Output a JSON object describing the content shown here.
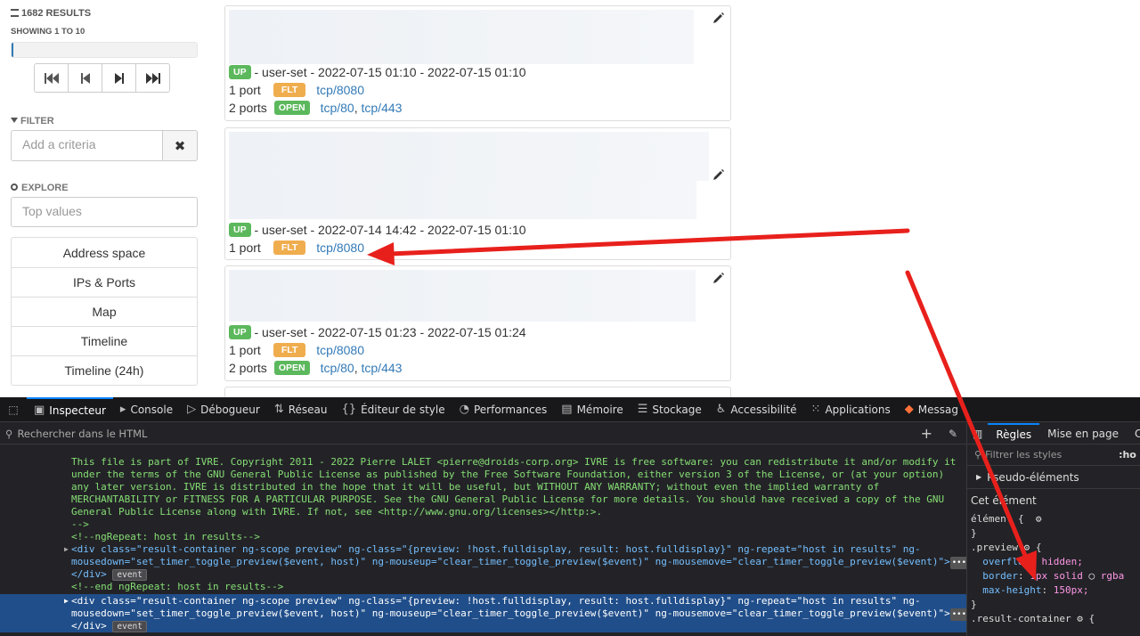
{
  "sidebar": {
    "results_count": "1682 RESULTS",
    "showing": "SHOWING 1 TO 10",
    "progress_fraction": 0.01,
    "filter_title": "FILTER",
    "filter_placeholder": "Add a criteria",
    "explore_title": "EXPLORE",
    "explore_placeholder": "Top values",
    "explore_items": [
      "Address space",
      "IPs & Ports",
      "Map",
      "Timeline",
      "Timeline (24h)"
    ]
  },
  "results": [
    {
      "status": "UP",
      "summary": "- user-set - 2022-07-15 01:10 - 2022-07-15 01:10",
      "flt_count": "1 port",
      "flt_label": "FLT",
      "flt_ports": "tcp/8080",
      "open_count": "2 ports",
      "open_label": "OPEN",
      "open_port_1": "tcp/80",
      "open_port_2": "tcp/443"
    },
    {
      "status": "UP",
      "summary": "- user-set - 2022-07-14 14:42 - 2022-07-15 01:10",
      "flt_count": "1 port",
      "flt_label": "FLT",
      "flt_ports": "tcp/8080"
    },
    {
      "status": "UP",
      "summary": "- user-set - 2022-07-15 01:23 - 2022-07-15 01:24",
      "flt_count": "1 port",
      "flt_label": "FLT",
      "flt_ports": "tcp/8080",
      "open_count": "2 ports",
      "open_label": "OPEN",
      "open_port_1": "tcp/80",
      "open_port_2": "tcp/443"
    }
  ],
  "devtools": {
    "tabs": [
      "Inspecteur",
      "Console",
      "Débogueur",
      "Réseau",
      "Éditeur de style",
      "Performances",
      "Mémoire",
      "Stockage",
      "Accessibilité",
      "Applications",
      "Messag"
    ],
    "search_placeholder": "Rechercher dans le HTML",
    "html_lines": {
      "l1": "This file is part of IVRE. Copyright 2011 - 2022 Pierre LALET <pierre@droids-corp.org> IVRE is free software: you can redistribute it and/or modify it",
      "l2": "under the terms of the GNU General Public License as published by the Free Software Foundation, either version 3 of the License, or (at your option)",
      "l3": "any later version. IVRE is distributed in the hope that it will be useful, but WITHOUT ANY WARRANTY; without even the implied warranty of",
      "l4": "MERCHANTABILITY or FITNESS FOR A PARTICULAR PURPOSE. See the GNU General Public License for more details. You should have received a copy of the GNU",
      "l5": "General Public License along with IVRE. If not, see <http://www.gnu.org/licenses></http:>.",
      "l6": "-->",
      "l7": "<!--ngRepeat: host in results-->",
      "div_open": "<div class=\"result-container ng-scope preview\" ng-class=\"{preview: !host.fulldisplay, result: host.fulldisplay}\" ng-repeat=\"host in results\" ng-",
      "div_open_2": "mousedown=\"set_timer_toggle_preview($event, host)\" ng-mouseup=\"clear_timer_toggle_preview($event)\" ng-mousemove=\"clear_timer_toggle_preview($event)\">",
      "div_close": "</div>",
      "event": "event",
      "end_repeat": "<!--end ngRepeat: host in results-->",
      "ellipsis": "•••"
    },
    "rules_tabs": [
      "Règles",
      "Mise en page",
      "C"
    ],
    "rules_filter": "Filtrer les styles",
    "rules_filter_right": ":ho",
    "pseudo": "Pseudo-éléments",
    "this_element": "Cet élément",
    "element_rule": "élément",
    "preview_selector": ".preview",
    "prop_overflow": "overflow",
    "val_overflow": "hidden;",
    "prop_border": "border",
    "val_border": "1px solid",
    "val_border_color": "rgba",
    "prop_maxh": "max-height",
    "val_maxh": "150px;",
    "next_selector": ".result-container"
  },
  "colors": {
    "accent": "#337ab7",
    "up": "#5cb85c",
    "flt": "#f0ad4e",
    "devtools_bg": "#232327",
    "selection": "#204e8a",
    "arrow": "#e8201c"
  }
}
